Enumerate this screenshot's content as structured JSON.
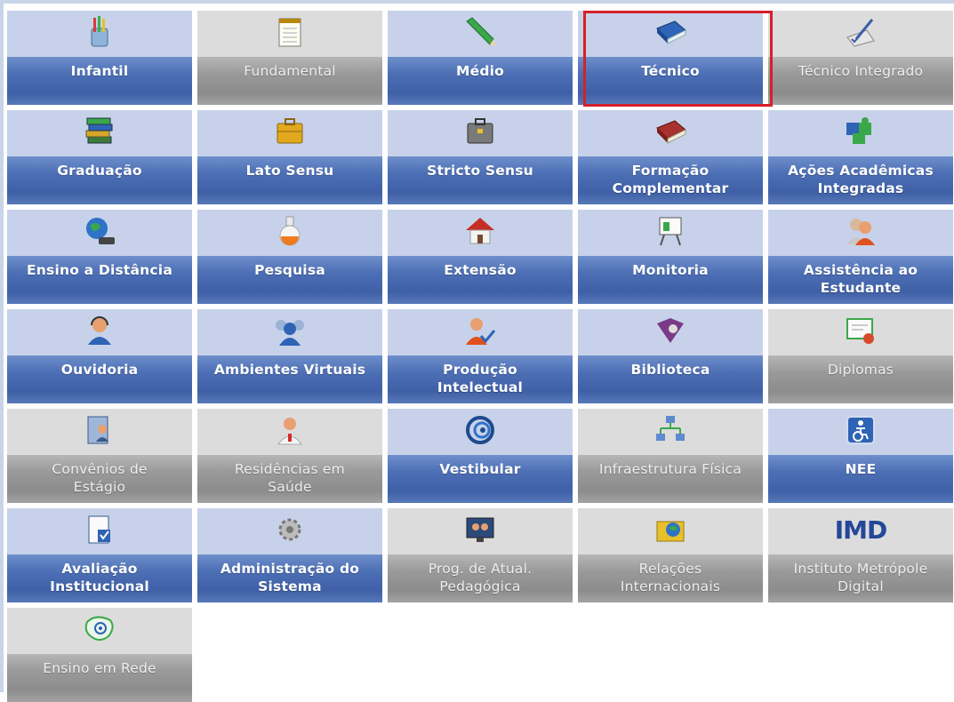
{
  "colors": {
    "active_bar": "#4d6fb5",
    "active_top": "#c7d2ea",
    "inactive_bar": "#9a9a9a",
    "inactive_top": "#dcdcdc",
    "selection_border": "#d6202a"
  },
  "modules": [
    {
      "id": "infantil",
      "label1": "Infantil",
      "label2": "",
      "state": "active",
      "icon": "pencil-cup-icon"
    },
    {
      "id": "fundamental",
      "label1": "Fundamental",
      "label2": "",
      "state": "inactive",
      "icon": "notepad-icon"
    },
    {
      "id": "medio",
      "label1": "Médio",
      "label2": "",
      "state": "active",
      "icon": "pencil-icon"
    },
    {
      "id": "tecnico",
      "label1": "Técnico",
      "label2": "",
      "state": "active",
      "icon": "blue-book-icon",
      "selected": true
    },
    {
      "id": "tecnico-integrado",
      "label1": "Técnico Integrado",
      "label2": "",
      "state": "inactive",
      "icon": "checklist-pen-icon"
    },
    {
      "id": "graduacao",
      "label1": "Graduação",
      "label2": "",
      "state": "active",
      "icon": "book-stack-icon"
    },
    {
      "id": "lato-sensu",
      "label1": "Lato Sensu",
      "label2": "",
      "state": "active",
      "icon": "yellow-briefcase-icon"
    },
    {
      "id": "stricto-sensu",
      "label1": "Stricto Sensu",
      "label2": "",
      "state": "active",
      "icon": "gray-briefcase-icon"
    },
    {
      "id": "formacao-complementar",
      "label1": "Formação",
      "label2": "Complementar",
      "state": "active",
      "icon": "red-book-icon"
    },
    {
      "id": "acoes-academicas",
      "label1": "Ações Acadêmicas",
      "label2": "Integradas",
      "state": "active",
      "icon": "puzzle-icon"
    },
    {
      "id": "ensino-distancia",
      "label1": "Ensino a Distância",
      "label2": "",
      "state": "active",
      "icon": "globe-computer-icon"
    },
    {
      "id": "pesquisa",
      "label1": "Pesquisa",
      "label2": "",
      "state": "active",
      "icon": "flask-icon"
    },
    {
      "id": "extensao",
      "label1": "Extensão",
      "label2": "",
      "state": "active",
      "icon": "house-icon"
    },
    {
      "id": "monitoria",
      "label1": "Monitoria",
      "label2": "",
      "state": "active",
      "icon": "presentation-board-icon"
    },
    {
      "id": "assistencia-estudante",
      "label1": "Assistência ao",
      "label2": "Estudante",
      "state": "active",
      "icon": "users-icon"
    },
    {
      "id": "ouvidoria",
      "label1": "Ouvidoria",
      "label2": "",
      "state": "active",
      "icon": "headset-user-icon"
    },
    {
      "id": "ambientes-virtuais",
      "label1": "Ambientes Virtuais",
      "label2": "",
      "state": "active",
      "icon": "user-group-icon"
    },
    {
      "id": "producao-intelectual",
      "label1": "Produção",
      "label2": "Intelectual",
      "state": "active",
      "icon": "user-check-icon"
    },
    {
      "id": "biblioteca",
      "label1": "Biblioteca",
      "label2": "",
      "state": "active",
      "icon": "open-book-icon"
    },
    {
      "id": "diplomas",
      "label1": "Diplomas",
      "label2": "",
      "state": "inactive",
      "icon": "certificate-icon"
    },
    {
      "id": "convenios-estagio",
      "label1": "Convênios de",
      "label2": "Estágio",
      "state": "inactive",
      "icon": "contact-book-icon"
    },
    {
      "id": "residencias-saude",
      "label1": "Residências em",
      "label2": "Saúde",
      "state": "inactive",
      "icon": "doctor-icon"
    },
    {
      "id": "vestibular",
      "label1": "Vestibular",
      "label2": "",
      "state": "active",
      "icon": "spiral-logo-icon"
    },
    {
      "id": "infraestrutura-fisica",
      "label1": "Infraestrutura Física",
      "label2": "",
      "state": "inactive",
      "icon": "network-icon"
    },
    {
      "id": "nee",
      "label1": "NEE",
      "label2": "",
      "state": "active",
      "icon": "accessibility-icon"
    },
    {
      "id": "avaliacao-institucional",
      "label1": "Avaliação",
      "label2": "Institucional",
      "state": "active",
      "icon": "document-check-icon"
    },
    {
      "id": "administracao-sistema",
      "label1": "Administração do",
      "label2": "Sistema",
      "state": "active",
      "icon": "gears-icon"
    },
    {
      "id": "prog-atual-pedagogica",
      "label1": "Prog. de Atual.",
      "label2": "Pedagógica",
      "state": "inactive",
      "icon": "video-conference-icon"
    },
    {
      "id": "relacoes-internacionais",
      "label1": "Relações",
      "label2": "Internacionais",
      "state": "inactive",
      "icon": "globe-folder-icon"
    },
    {
      "id": "instituto-metropole",
      "label1": "Instituto Metrópole",
      "label2": "Digital",
      "state": "inactive",
      "icon": "imd-logo-icon",
      "logo_text": "IMD"
    },
    {
      "id": "ensino-em-rede",
      "label1": "Ensino em Rede",
      "label2": "",
      "state": "inactive",
      "icon": "brazil-at-icon"
    }
  ]
}
